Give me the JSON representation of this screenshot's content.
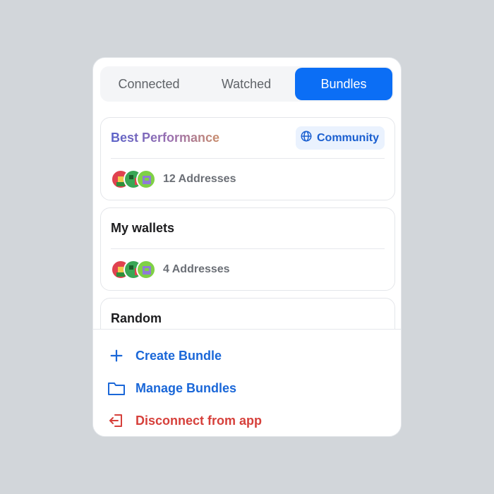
{
  "tabs": [
    {
      "label": "Connected",
      "active": false
    },
    {
      "label": "Watched",
      "active": false
    },
    {
      "label": "Bundles",
      "active": true
    }
  ],
  "bundles": [
    {
      "title": "Best Performance",
      "badge": "Community",
      "addresses": "12 Addresses"
    },
    {
      "title": "My wallets",
      "badge": "",
      "addresses": "4 Addresses"
    },
    {
      "title": "Random",
      "badge": "",
      "addresses": ""
    }
  ],
  "actions": {
    "create": "Create Bundle",
    "manage": "Manage Bundles",
    "disconnect": "Disconnect from app"
  },
  "colors": {
    "accent": "#0b6ef5",
    "link": "#1a67d8",
    "danger": "#d6403b",
    "badge_bg": "#eaf2fe"
  },
  "icons": {
    "community": "globe-icon",
    "create": "plus-icon",
    "manage": "folder-icon",
    "disconnect": "logout-icon"
  }
}
